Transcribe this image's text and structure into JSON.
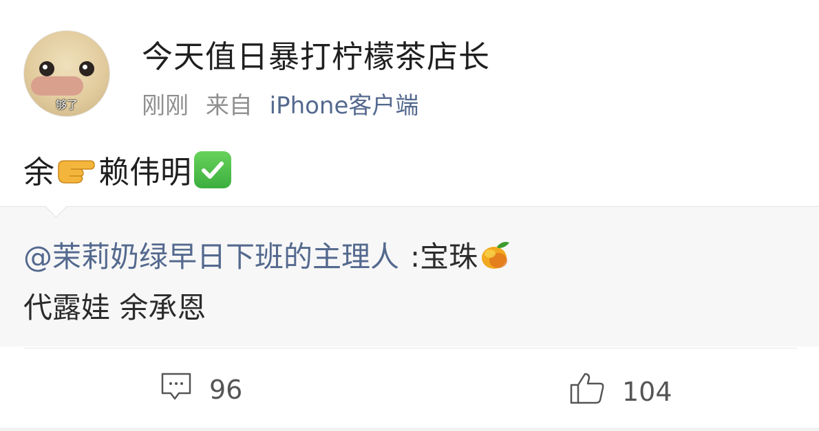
{
  "post": {
    "username": "今天值日暴打柠檬茶店长",
    "time": "刚刚",
    "source_prefix": "来自",
    "source": "iPhone客户端",
    "avatar_caption": "够了",
    "text_before": "余",
    "text_after": "赖伟明",
    "emojis": [
      "backhand-pointing-right-icon",
      "check-mark-button-icon",
      "mango-icon"
    ]
  },
  "quote": {
    "mention": "@茉莉奶绿早日下班的主理人",
    "text": ":宝珠",
    "line2": "代露娃 余承恩"
  },
  "actions": {
    "comments": "96",
    "likes": "104"
  },
  "colors": {
    "link": "#54698e",
    "meta": "#8f8f8f",
    "quote_bg": "#f7f7f7"
  }
}
